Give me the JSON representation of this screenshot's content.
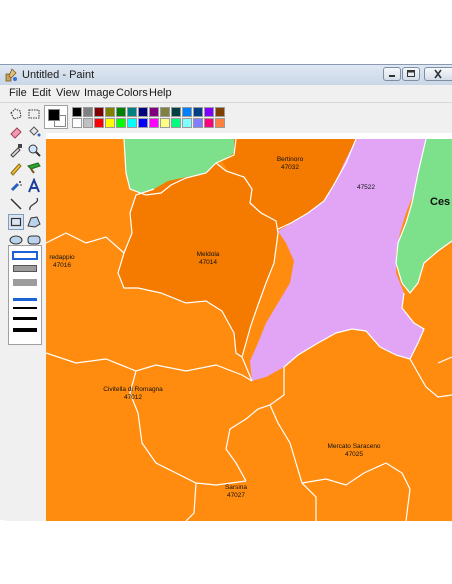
{
  "window": {
    "title": "Untitled - Paint"
  },
  "menu": [
    {
      "label": "File"
    },
    {
      "label": "Edit"
    },
    {
      "label": "View"
    },
    {
      "label": "Image"
    },
    {
      "label": "Colors"
    },
    {
      "label": "Help"
    }
  ],
  "colors": {
    "foreground": "#000000",
    "background": "#ffffff",
    "palette_top": [
      "#000000",
      "#808080",
      "#800000",
      "#808000",
      "#008000",
      "#008080",
      "#000080",
      "#800080",
      "#808040",
      "#004040",
      "#0080ff",
      "#004080",
      "#8000ff",
      "#804000"
    ],
    "palette_bottom": [
      "#ffffff",
      "#c0c0c0",
      "#ff0000",
      "#ffff00",
      "#00ff00",
      "#00ffff",
      "#0000ff",
      "#ff00ff",
      "#ffff80",
      "#00ff80",
      "#80ffff",
      "#8080ff",
      "#ff0080",
      "#ff8040"
    ],
    "map_orange": "#ff8c0f",
    "map_dark_orange": "#f47b00",
    "map_green": "#7de08a",
    "map_violet": "#e2a5f5"
  },
  "map": {
    "regions": [
      {
        "name": "Bertinoro",
        "code": "47032"
      },
      {
        "name": "",
        "code": "47522"
      },
      {
        "name": "Ces",
        "code": ""
      },
      {
        "name": "redappio",
        "code": "47016"
      },
      {
        "name": "Meldola",
        "code": "47014"
      },
      {
        "name": "Civitella di Romagna",
        "code": "47012"
      },
      {
        "name": "Mercato Saraceno",
        "code": "47025"
      },
      {
        "name": "Sarsina",
        "code": "47027"
      }
    ]
  }
}
